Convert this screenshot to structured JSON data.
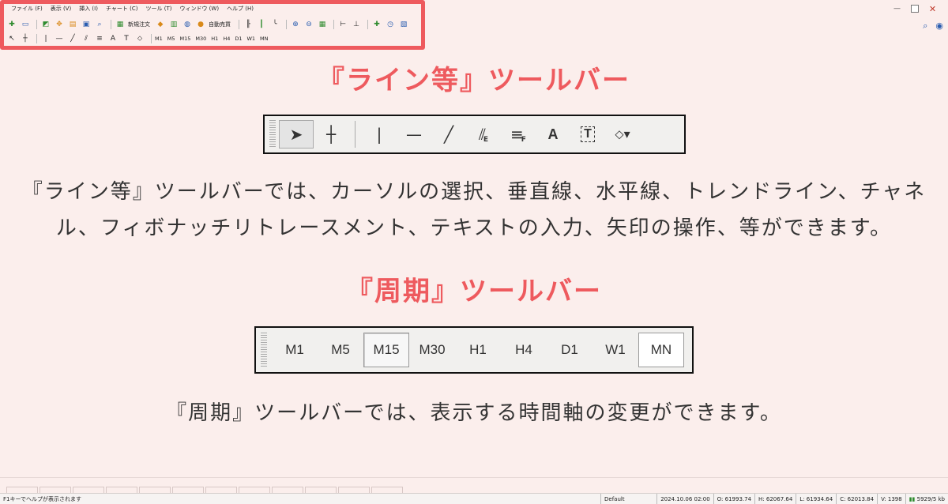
{
  "menu": [
    "ファイル (F)",
    "表示 (V)",
    "挿入 (I)",
    "チャート (C)",
    "ツール (T)",
    "ウィンドウ (W)",
    "ヘルプ (H)"
  ],
  "toolbar": {
    "new_order": "新規注文",
    "auto_trading": "自動売買",
    "timeframes": [
      "M1",
      "M5",
      "M15",
      "M30",
      "H1",
      "H4",
      "D1",
      "W1",
      "MN"
    ]
  },
  "sections": {
    "lines": {
      "heading": "『ライン等』ツールバー",
      "toolbar_buttons": [
        {
          "name": "cursor-icon",
          "glyph": "↖"
        },
        {
          "name": "crosshair-icon",
          "glyph": "┼"
        },
        {
          "name": "vertical-line-icon",
          "glyph": "|"
        },
        {
          "name": "horizontal-line-icon",
          "glyph": "—"
        },
        {
          "name": "trendline-icon",
          "glyph": "╱"
        },
        {
          "name": "equidistant-channel-icon",
          "glyph": "⫽",
          "sub": "E"
        },
        {
          "name": "fibonacci-icon",
          "glyph": "≡",
          "sub": "F"
        },
        {
          "name": "text-icon",
          "glyph": "A"
        },
        {
          "name": "text-label-icon",
          "glyph": "T"
        },
        {
          "name": "arrows-icon",
          "glyph": "⬦▾"
        }
      ],
      "description_line1": "『ライン等』ツールバーでは、カーソルの選択、垂直線、水平線、トレンドライン、チャネ",
      "description_line2": "ル、フィボナッチリトレースメント、テキストの入力、矢印の操作、等ができます。"
    },
    "period": {
      "heading": "『周期』ツールバー",
      "buttons": [
        "M1",
        "M5",
        "M15",
        "M30",
        "H1",
        "H4",
        "D1",
        "W1",
        "MN"
      ],
      "active": "M15",
      "description": "『周期』ツールバーでは、表示する時間軸の変更ができます。"
    }
  },
  "statusbar": {
    "help": "F1キーでヘルプが表示されます",
    "profile": "Default",
    "datetime": "2024.10.06 02:00",
    "open": "O: 61993.74",
    "high": "H: 62067.64",
    "low": "L: 61934.64",
    "close": "C: 62013.84",
    "volume": "V: 1398",
    "traffic": "5929/5 kb"
  },
  "colors": {
    "accent": "#ee5a5e",
    "background": "#fbeeec"
  }
}
